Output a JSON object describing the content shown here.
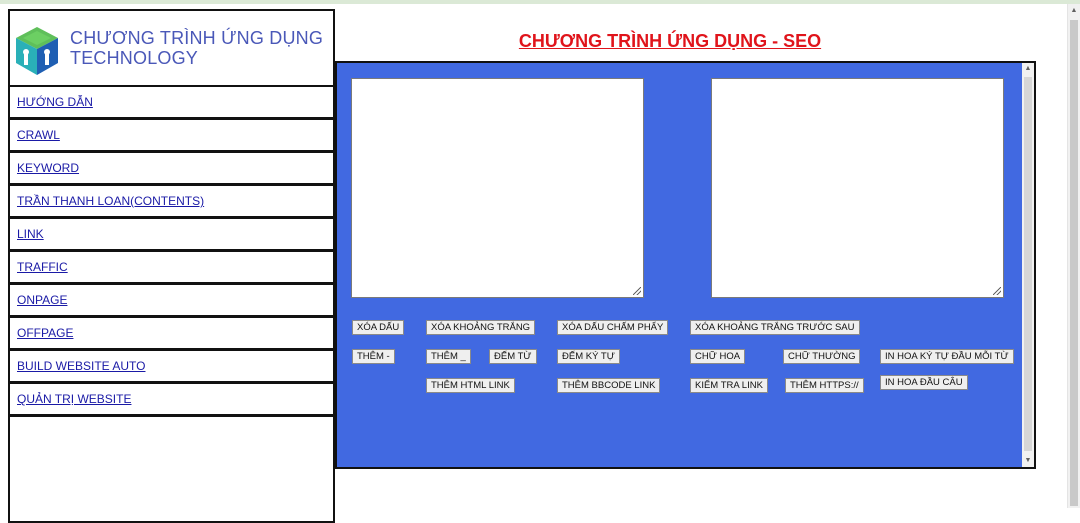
{
  "logo": {
    "icon": "cube-icon",
    "line1": "CHƯƠNG TRÌNH ỨNG DỤNG",
    "line2": "TECHNOLOGY",
    "colors": {
      "green": "#5fbf5a",
      "teal": "#2ab0b8",
      "blue": "#1f5fb3"
    }
  },
  "menu": [
    {
      "label": "HƯỚNG DẪN"
    },
    {
      "label": "CRAWL"
    },
    {
      "label": "KEYWORD"
    },
    {
      "label": "TRẦN THANH LOAN(CONTENTS)"
    },
    {
      "label": "LINK"
    },
    {
      "label": "TRAFFIC"
    },
    {
      "label": "ONPAGE"
    },
    {
      "label": "OFFPAGE"
    },
    {
      "label": "BUILD WEBSITE AUTO"
    },
    {
      "label": "QUẢN TRỊ WEBSITE"
    }
  ],
  "main": {
    "title": "CHƯƠNG TRÌNH ỨNG DỤNG - SEO",
    "title_color": "#e0141b",
    "panel_color": "#4169e1",
    "input_text": {
      "value": "",
      "placeholder": ""
    },
    "output_text": {
      "value": "",
      "placeholder": ""
    },
    "buttons": {
      "xoa_dau": "XÓA DẤU",
      "xoa_khoang_trang": "XÓA KHOẢNG TRẮNG",
      "xoa_dau_cham_phay": "XÓA DẤU CHẤM PHẨY",
      "xoa_khoang_trang_truoc_sau": "XÓA KHOẢNG TRẮNG TRƯỚC SAU",
      "them_gach_ngang": "THÊM -",
      "them_gach_duoi": "THÊM _",
      "dem_tu": "ĐẾM TỪ",
      "dem_ky_tu": "ĐẾM KÝ TỰ",
      "chu_hoa": "CHỮ HOA",
      "chu_thuong": "CHỮ THƯỜNG",
      "in_hoa_ky_tu_dau_moi_tu": "IN HOA KÝ TỰ ĐẦU MỖI TỪ",
      "them_html_link": "THÊM HTML LINK",
      "them_bbcode_link": "THÊM BBCODE LINK",
      "kiem_tra_link": "KIỂM TRA LINK",
      "them_https": "THÊM HTTPS://",
      "in_hoa_dau_cau": "IN HOA ĐẦU CÂU"
    }
  }
}
